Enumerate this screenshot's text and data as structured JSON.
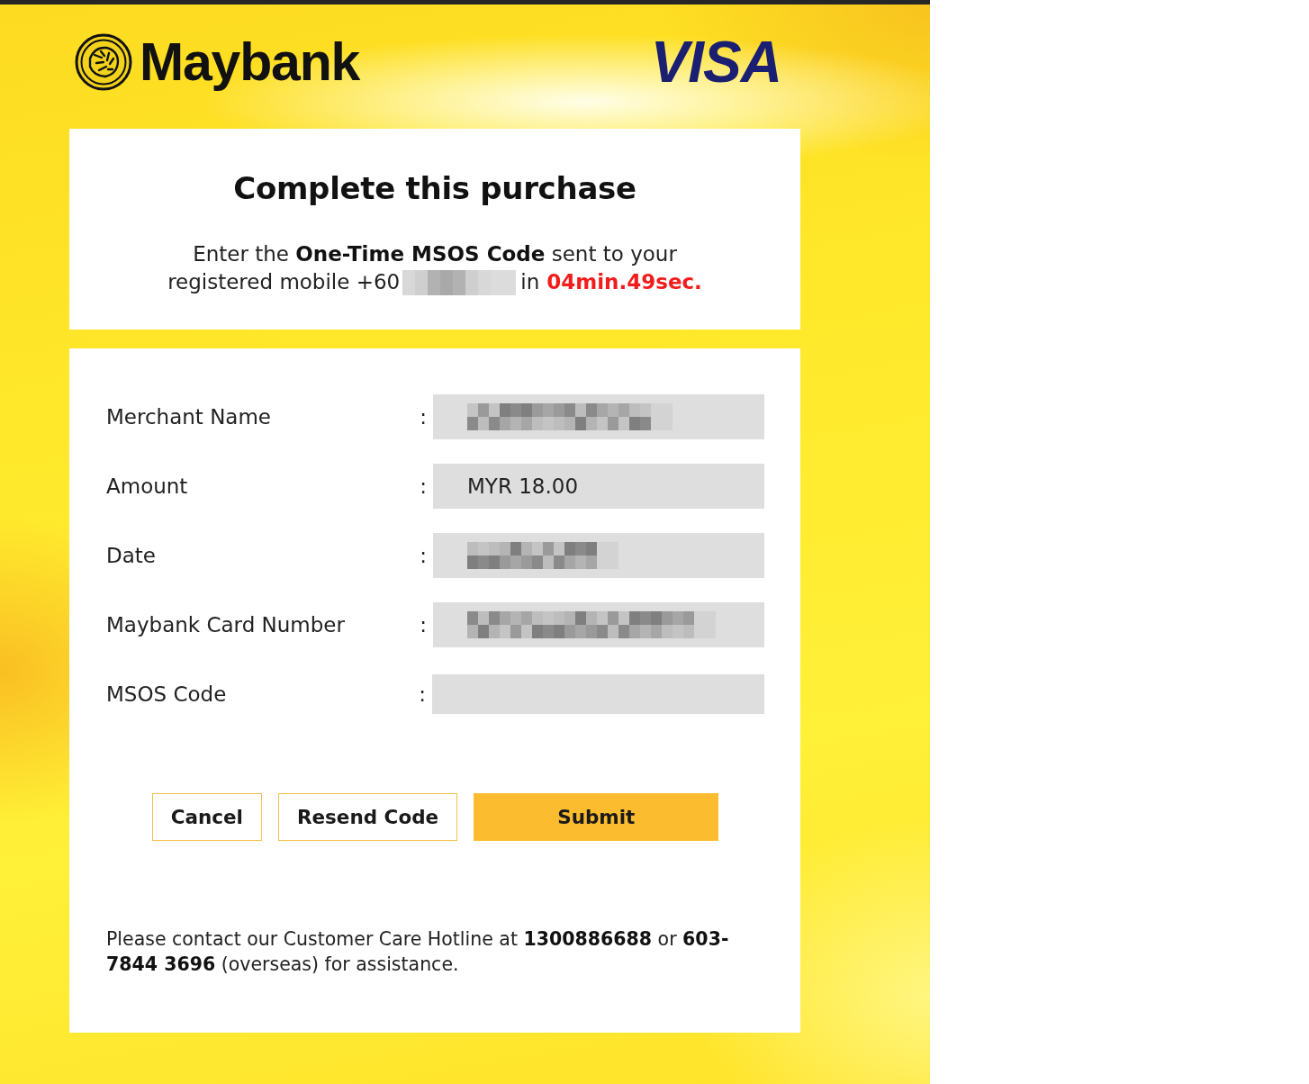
{
  "header": {
    "bank_name": "Maybank",
    "card_brand": "VISA"
  },
  "prompt": {
    "title": "Complete this purchase",
    "text": "Enter the **One-Time MSOS Code** sent to your",
    "mobile_prefix": "registered mobile +60",
    "mobile_redacted": true,
    "countdown_prefix": "in",
    "countdown": "04min.49sec."
  },
  "details": [
    {
      "label": "Merchant Name",
      "separator": ":",
      "kind": "redacted"
    },
    {
      "label": "Amount",
      "separator": ":",
      "kind": "text",
      "value": "MYR 18.00"
    },
    {
      "label": "Date",
      "separator": ":",
      "kind": "redacted"
    },
    {
      "label": "Maybank Card Number",
      "separator": ":",
      "kind": "redacted"
    },
    {
      "label": "MSOS Code",
      "separator": ":",
      "kind": "input"
    }
  ],
  "buttons": [
    {
      "label": "Cancel",
      "kind": "outline"
    },
    {
      "label": "Resend Code",
      "kind": "outline"
    },
    {
      "label": "Submit",
      "kind": "primary"
    }
  ],
  "footer": {
    "text": "Please contact our Customer Care Hotline at **1300886688** or **603-7844 3696** (overseas) for assistance."
  }
}
